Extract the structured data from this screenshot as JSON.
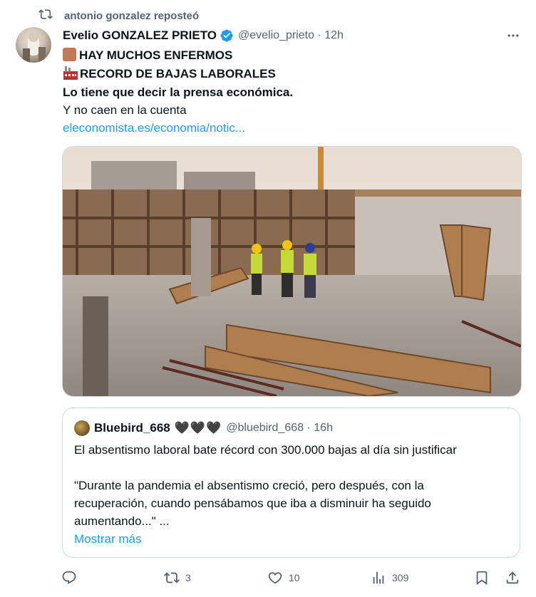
{
  "repost": {
    "label": "antonio gonzalez reposteó"
  },
  "post": {
    "author_name": "Evelio GONZALEZ PRIETO",
    "handle_time": "@evelio_prieto · 12h",
    "lines": {
      "l1": "HAY MUCHOS ENFERMOS",
      "l2": "RECORD DE BAJAS LABORALES",
      "l3": "Lo tiene que decir la prensa económica.",
      "l4": "Y no caen en la cuenta",
      "link": "eleconomista.es/economia/notic..."
    }
  },
  "quote": {
    "name": "Bluebird_668",
    "hearts": "🖤🖤🖤",
    "handle_time": "@bluebird_668 · 16h",
    "l1": "El absentismo laboral bate récord con 300.000 bajas al día sin justificar",
    "l2": "\"Durante la pandemia el absentismo creció, pero después, con la",
    "l3": "recuperación, cuando pensábamos que iba a disminuir ha seguido",
    "l4": "aumentando...\" ...",
    "more": "Mostrar más"
  },
  "actions": {
    "reposts": "3",
    "likes": "10",
    "views": "309"
  }
}
